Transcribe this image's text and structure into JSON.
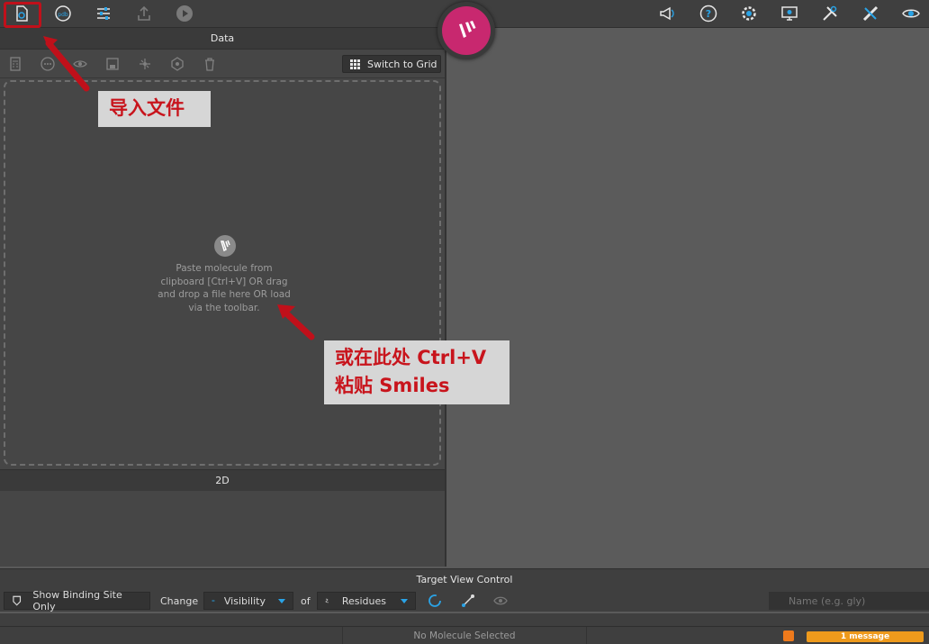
{
  "panels": {
    "data_title": "Data",
    "two_d_title": "2D",
    "switch_grid_label": "Switch to Grid",
    "drop_text": "Paste molecule from clipboard [Ctrl+V] OR drag and drop a file here OR load via the toolbar."
  },
  "target_view": {
    "title": "Target View Control",
    "show_binding_site": "Show Binding Site Only",
    "change": "Change",
    "visibility": "Visibility",
    "of": "of",
    "residues": "Residues",
    "name_placeholder": "Name (e.g. gly)"
  },
  "status": {
    "selection": "No Molecule Selected",
    "messages": "1 message"
  },
  "annotations": {
    "import_file": "导入文件",
    "paste_line1": "或在此处 Ctrl+V",
    "paste_line2": "粘贴 Smiles"
  },
  "icons": {
    "top_left": [
      "import-file-icon",
      "file-icon",
      "settings-sliders-icon",
      "upload-icon",
      "play-icon"
    ],
    "top_right": [
      "megaphone-icon",
      "help-icon",
      "gear-icon",
      "monitor-icon",
      "tools-icon",
      "ruler-icon",
      "eye-icon"
    ],
    "data_toolbar": [
      "calculator-icon",
      "more-icon",
      "eye-icon",
      "save-icon",
      "network-icon",
      "badge-icon",
      "trash-icon"
    ]
  },
  "colors": {
    "logo": "#c8286f",
    "annotation_text": "#c8141c",
    "annotation_bg": "#d6d6d6",
    "message_badge": "#ee9a1c",
    "accent": "#2aa3e6"
  }
}
